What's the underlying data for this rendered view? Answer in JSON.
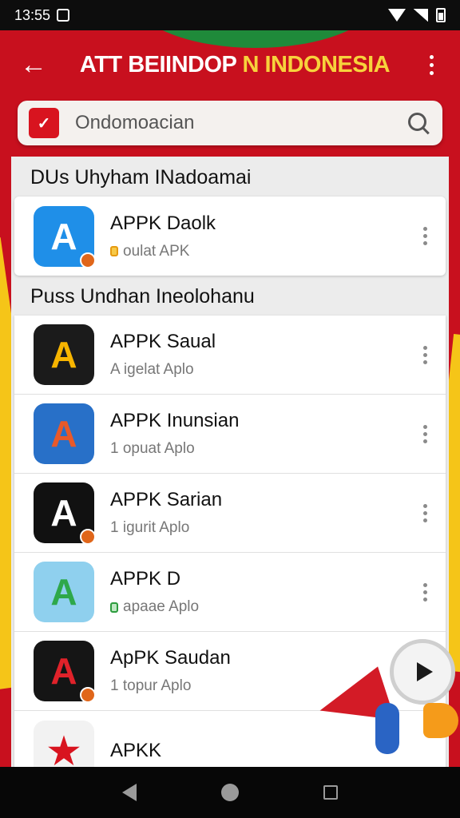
{
  "status_bar": {
    "time": "13:55"
  },
  "app_bar": {
    "title_main": "ATT BEIINDOP",
    "title_accent": "N INDONESIA"
  },
  "search": {
    "value": "Ondomoacian"
  },
  "sections": [
    {
      "title": "DUs Uhyham INadoamai",
      "items": [
        {
          "name": "APPK Daolk",
          "sub": "oulat APK",
          "icon": "app-a-blue-icon",
          "bg": "#1f8fe8",
          "fg": "#ffffff",
          "letter": "A",
          "dot": "yellow"
        }
      ]
    },
    {
      "title": "Puss Undhan Ineolohanu",
      "items": [
        {
          "name": "APPK Saual",
          "sub": "A igelat Aplo",
          "icon": "app-a-yellow-icon",
          "bg": "#1b1b1b",
          "fg": "#f7b500",
          "letter": "A"
        },
        {
          "name": "APPK Inunsian",
          "sub": "1 opuat Aplo",
          "icon": "app-a-gradient-icon",
          "bg": "#2870c8",
          "fg": "#e8592a",
          "letter": "A"
        },
        {
          "name": "APPK Sarian",
          "sub": "1 igurit Aplo",
          "icon": "app-a-outline-icon",
          "bg": "#111111",
          "fg": "#ffffff",
          "letter": "A"
        },
        {
          "name": "APPK D",
          "sub": "apaae Aplo",
          "icon": "app-a-green-icon",
          "bg": "#8fd0ee",
          "fg": "#2ea84a",
          "letter": "A",
          "dot": "green"
        },
        {
          "name": "ApPK Saudan",
          "sub": "1 topur Aplo",
          "icon": "app-a-red-icon",
          "bg": "#151515",
          "fg": "#e0222a",
          "letter": "A"
        },
        {
          "name": "APKK",
          "sub": "",
          "icon": "app-star-icon",
          "bg": "#f2f2f2",
          "fg": "#d8141f",
          "letter": "★"
        }
      ]
    }
  ],
  "colors": {
    "brand_red": "#c8101e",
    "accent_yellow": "#f7d23c"
  }
}
